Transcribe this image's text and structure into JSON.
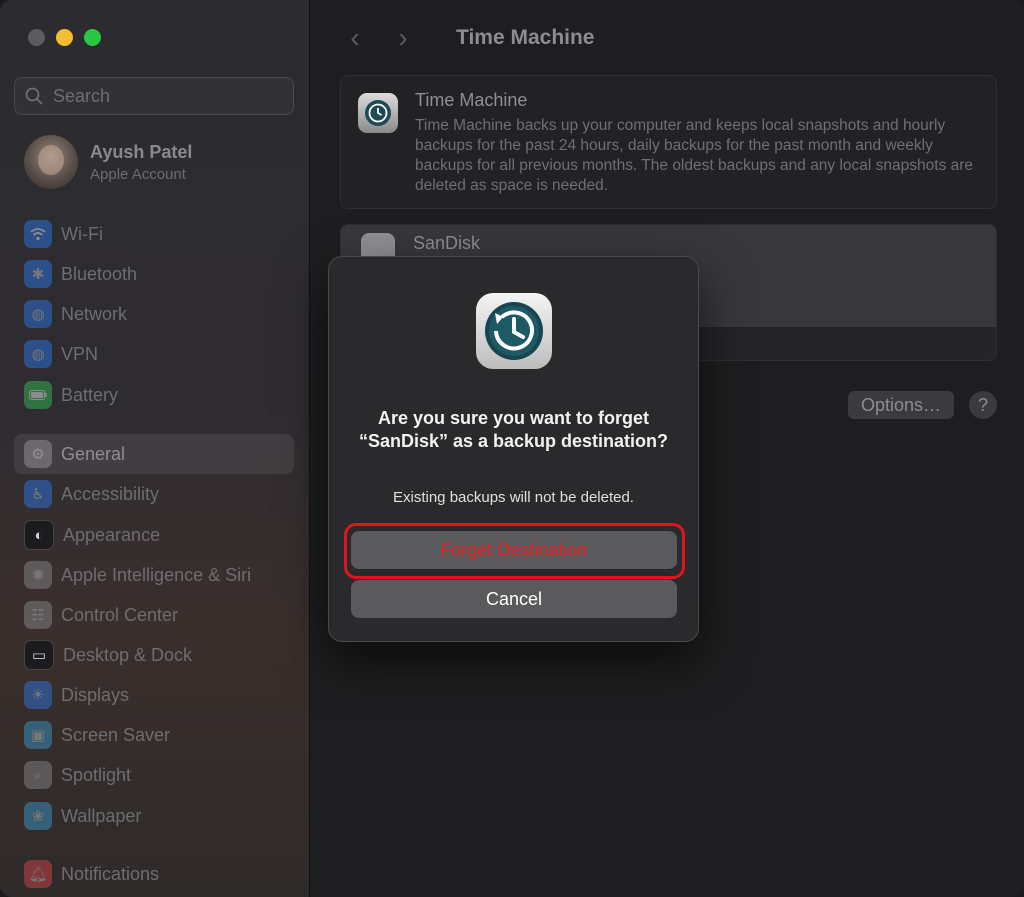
{
  "sidebar": {
    "search_placeholder": "Search",
    "account": {
      "name": "Ayush Patel",
      "subtitle": "Apple Account"
    },
    "items": [
      {
        "label": "Wi-Fi",
        "icon": "wifi-icon",
        "color": "#2b7cf6"
      },
      {
        "label": "Bluetooth",
        "icon": "bluetooth-icon",
        "color": "#2b7cf6"
      },
      {
        "label": "Network",
        "icon": "network-globe-icon",
        "color": "#2b7cf6"
      },
      {
        "label": "VPN",
        "icon": "vpn-globe-icon",
        "color": "#2b7cf6"
      },
      {
        "label": "Battery",
        "icon": "battery-icon",
        "color": "#35c759"
      },
      {
        "label": "General",
        "icon": "gear-icon",
        "color": "#8e8e93"
      },
      {
        "label": "Accessibility",
        "icon": "accessibility-icon",
        "color": "#2b7cf6"
      },
      {
        "label": "Appearance",
        "icon": "appearance-icon",
        "color": "#1c1c1e"
      },
      {
        "label": "Apple Intelligence & Siri",
        "icon": "siri-icon",
        "color": "#c86bd8"
      },
      {
        "label": "Control Center",
        "icon": "control-center-icon",
        "color": "#8e8e93"
      },
      {
        "label": "Desktop & Dock",
        "icon": "dock-icon",
        "color": "#1c1c1e"
      },
      {
        "label": "Displays",
        "icon": "sun-icon",
        "color": "#2b7cf6"
      },
      {
        "label": "Screen Saver",
        "icon": "screen-saver-icon",
        "color": "#3aa0d8"
      },
      {
        "label": "Spotlight",
        "icon": "magnifier-icon",
        "color": "#8e8e93"
      },
      {
        "label": "Wallpaper",
        "icon": "flower-icon",
        "color": "#3aa0d8"
      },
      {
        "label": "Notifications",
        "icon": "bell-icon",
        "color": "#e5484d"
      }
    ]
  },
  "main": {
    "title": "Time Machine",
    "info": {
      "title": "Time Machine",
      "description": "Time Machine backs up your computer and keeps local snapshots and hourly backups for the past 24 hours, daily backups for the past month and weekly backups for all previous months. The oldest backups and any local snapshots are deleted as space is needed."
    },
    "disk": {
      "name": "SanDisk"
    },
    "options_label": "Options…",
    "help_label": "?"
  },
  "dialog": {
    "title": "Are you sure you want to forget “SanDisk” as a backup destination?",
    "message": "Existing backups will not be deleted.",
    "forget_label": "Forget Destination",
    "cancel_label": "Cancel"
  }
}
